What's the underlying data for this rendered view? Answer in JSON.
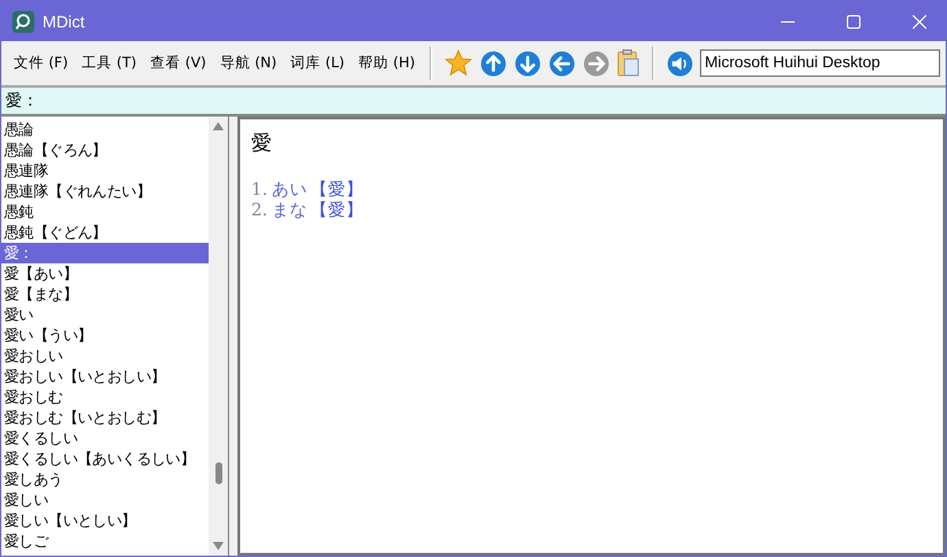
{
  "window": {
    "title": "MDict"
  },
  "menu": [
    "文件 (F)",
    "工具 (T)",
    "查看 (V)",
    "导航 (N)",
    "词库 (L)",
    "帮助 (H)"
  ],
  "toolbar": [
    {
      "kind": "star",
      "disabled": false
    },
    {
      "kind": "up",
      "disabled": false
    },
    {
      "kind": "down",
      "disabled": false
    },
    {
      "kind": "back",
      "disabled": false
    },
    {
      "kind": "forward",
      "disabled": true
    },
    {
      "kind": "clipboard",
      "disabled": false
    }
  ],
  "voice": {
    "value": "Microsoft Huihui Desktop"
  },
  "search": {
    "value": "愛："
  },
  "word_list": [
    {
      "text": "愚論",
      "selected": false
    },
    {
      "text": "愚論【ぐろん】",
      "selected": false
    },
    {
      "text": "愚連隊",
      "selected": false
    },
    {
      "text": "愚連隊【ぐれんたい】",
      "selected": false
    },
    {
      "text": "愚鈍",
      "selected": false
    },
    {
      "text": "愚鈍【ぐどん】",
      "selected": false
    },
    {
      "text": "愛：",
      "selected": true
    },
    {
      "text": "愛【あい】",
      "selected": false
    },
    {
      "text": "愛【まな】",
      "selected": false
    },
    {
      "text": "愛い",
      "selected": false
    },
    {
      "text": "愛い【うい】",
      "selected": false
    },
    {
      "text": "愛おしい",
      "selected": false
    },
    {
      "text": "愛おしい【いとおしい】",
      "selected": false
    },
    {
      "text": "愛おしむ",
      "selected": false
    },
    {
      "text": "愛おしむ【いとおしむ】",
      "selected": false
    },
    {
      "text": "愛くるしい",
      "selected": false
    },
    {
      "text": "愛くるしい【あいくるしい】",
      "selected": false
    },
    {
      "text": "愛しあう",
      "selected": false
    },
    {
      "text": "愛しい",
      "selected": false
    },
    {
      "text": "愛しい【いとしい】",
      "selected": false
    },
    {
      "text": "愛しご",
      "selected": false
    }
  ],
  "definition": {
    "headword": "愛",
    "entries": [
      {
        "number": "1.",
        "reading": "あい",
        "link": "【愛】"
      },
      {
        "number": "2.",
        "reading": "まな",
        "link": "【愛】"
      }
    ]
  }
}
